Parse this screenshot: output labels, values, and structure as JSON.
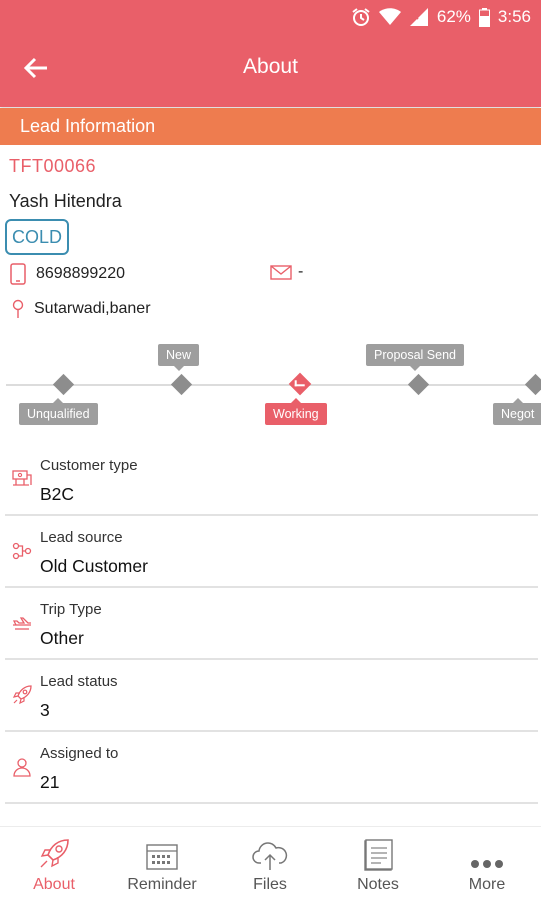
{
  "status_bar": {
    "battery": "62%",
    "time": "3:56"
  },
  "app_bar": {
    "title": "About"
  },
  "section": {
    "title": "Lead Information"
  },
  "lead": {
    "id": "TFT00066",
    "name": "Yash Hitendra",
    "temperature": "COLD",
    "phone": "8698899220",
    "email": "-",
    "address": "Sutarwadi,baner"
  },
  "pipeline": {
    "stages": [
      "Unqualified",
      "New",
      "Working",
      "Proposal Send",
      "Negot"
    ],
    "current_stage": "Working"
  },
  "fields": [
    {
      "label": "Customer type",
      "value": "B2C",
      "icon": "customer-type-icon"
    },
    {
      "label": "Lead source",
      "value": "Old Customer",
      "icon": "lead-source-icon"
    },
    {
      "label": "Trip Type",
      "value": "Other",
      "icon": "trip-type-icon"
    },
    {
      "label": "Lead status",
      "value": "3",
      "icon": "rocket-icon"
    },
    {
      "label": "Assigned to",
      "value": "21",
      "icon": "person-icon"
    }
  ],
  "bottom_nav": [
    {
      "label": "About",
      "icon": "rocket-icon",
      "active": true
    },
    {
      "label": "Reminder",
      "icon": "calendar-icon",
      "active": false
    },
    {
      "label": "Files",
      "icon": "cloud-upload-icon",
      "active": false
    },
    {
      "label": "Notes",
      "icon": "notes-icon",
      "active": false
    },
    {
      "label": "More",
      "icon": "more-dots-icon",
      "active": false
    }
  ],
  "colors": {
    "primary": "#e95f69",
    "section": "#ee7c4f",
    "badge": "#3b8db0",
    "stage": "#9e9e9e"
  }
}
